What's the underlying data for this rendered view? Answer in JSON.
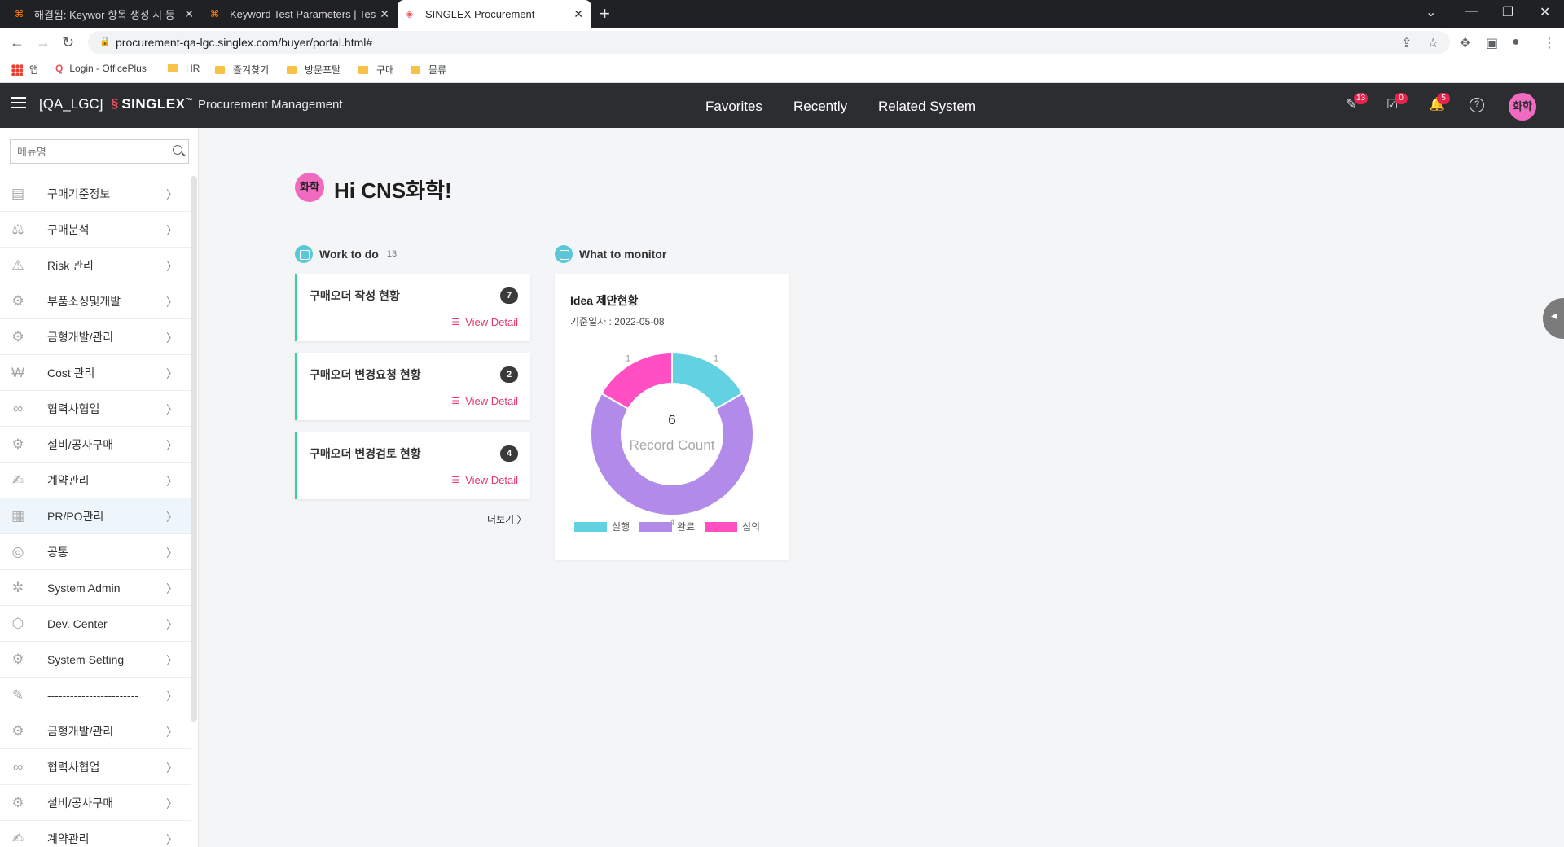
{
  "browser": {
    "tabs": [
      {
        "title": "해결됨: Keywor 항목 생성 시 등",
        "active": false
      },
      {
        "title": "Keyword Test Parameters | TestC",
        "active": false
      },
      {
        "title": "SINGLEX Procurement",
        "active": true
      }
    ],
    "url": "procurement-qa-lgc.singlex.com/buyer/portal.html#",
    "bookmarks": [
      "앱",
      "Login - OfficePlus",
      "HR",
      "즐겨찾기",
      "방문포탈",
      "구매",
      "물류"
    ]
  },
  "header": {
    "tenant": "[QA_LGC]",
    "brand": "SINGLEX",
    "trademark": "™",
    "product": "Procurement Management",
    "nav": [
      "Favorites",
      "Recently",
      "Related System"
    ],
    "badges": {
      "tasks": "13",
      "approvals": "0",
      "notifications": "5"
    },
    "avatar_text": "화학"
  },
  "sidebar": {
    "search_placeholder": "메뉴명",
    "items": [
      {
        "label": "구매기준정보",
        "icon": "building-list-icon"
      },
      {
        "label": "구매분석",
        "icon": "analysis-icon"
      },
      {
        "label": "Risk 관리",
        "icon": "warning-icon"
      },
      {
        "label": "부품소싱및개발",
        "icon": "gear-search-icon"
      },
      {
        "label": "금형개발/관리",
        "icon": "mold-gear-icon"
      },
      {
        "label": "Cost 관리",
        "icon": "cost-icon"
      },
      {
        "label": "협력사협업",
        "icon": "handshake-icon"
      },
      {
        "label": "설비/공사구매",
        "icon": "equipment-icon"
      },
      {
        "label": "계약관리",
        "icon": "contract-icon"
      },
      {
        "label": "PR/PO관리",
        "icon": "purchase-order-icon"
      },
      {
        "label": "공통",
        "icon": "common-icon"
      },
      {
        "label": "System Admin",
        "icon": "admin-icon"
      },
      {
        "label": "Dev. Center",
        "icon": "dev-cube-icon"
      },
      {
        "label": "System Setting",
        "icon": "settings-icon"
      },
      {
        "label": "------------------------",
        "icon": "edit-icon"
      },
      {
        "label": "금형개발/관리",
        "icon": "mold-gear-icon"
      },
      {
        "label": "협력사협업",
        "icon": "handshake-icon"
      },
      {
        "label": "설비/공사구매",
        "icon": "equipment-icon"
      },
      {
        "label": "계약관리",
        "icon": "contract-icon"
      }
    ]
  },
  "main": {
    "avatar_text": "화학",
    "greeting": "Hi CNS화학!",
    "work_to_do": {
      "title": "Work to do",
      "count": "13",
      "tasks": [
        {
          "title": "구매오더 작성 현황",
          "count": "7",
          "link": "View Detail"
        },
        {
          "title": "구매오더 변경요청 현황",
          "count": "2",
          "link": "View Detail"
        },
        {
          "title": "구매오더 변경검토 현황",
          "count": "4",
          "link": "View Detail"
        }
      ],
      "more": "더보기"
    },
    "what_to_monitor": {
      "title": "What to monitor",
      "card_title": "Idea 제안현황",
      "date_label": "기준일자 : 2022-05-08"
    }
  },
  "chart_data": {
    "type": "pie",
    "title": "Idea 제안현황",
    "center_value": "6",
    "center_label": "Record Count",
    "categories": [
      "실행",
      "완료",
      "심의"
    ],
    "values": [
      1,
      4,
      1
    ],
    "colors": [
      "#62d2e3",
      "#b28aea",
      "#ff4fc2"
    ]
  }
}
